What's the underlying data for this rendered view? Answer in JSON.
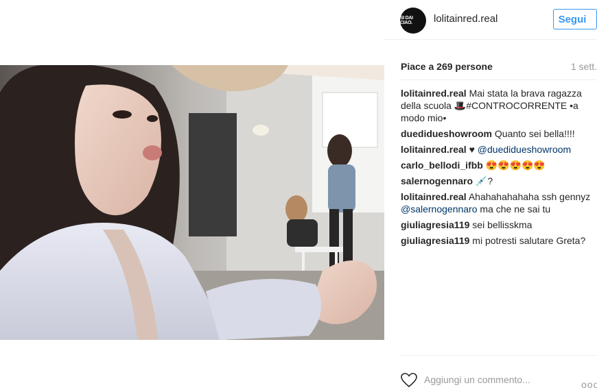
{
  "post": {
    "username": "lolitainred.real",
    "avatar_text": "SI DAI CIAO.",
    "follow_label": "Segui",
    "likes_text": "Piace a 269 persone",
    "time_text": "1 sett.",
    "add_comment_placeholder": "Aggiungi un commento...",
    "more_label": "ooo"
  },
  "comments": [
    {
      "user": "lolitainred.real",
      "pre": "",
      "mention": "",
      "text": "Mai stata la brava ragazza della scuola 🎩#CONTROCORRENTE •a modo mio•"
    },
    {
      "user": "duedidueshowroom",
      "pre": "",
      "mention": "",
      "text": "Quanto sei bella!!!!"
    },
    {
      "user": "lolitainred.real",
      "pre": "♥",
      "mention": "@duedidueshowroom",
      "text": ""
    },
    {
      "user": "carlo_bellodi_ifbb",
      "pre": "",
      "mention": "",
      "text": "😍😍😍😍😍"
    },
    {
      "user": "salernogennaro",
      "pre": "",
      "mention": "",
      "text": "💉?"
    },
    {
      "user": "lolitainred.real",
      "pre": "Ahahahahahaha ssh gennyz",
      "mention": "@salernogennaro",
      "text": "ma che ne sai tu"
    },
    {
      "user": "giuliagresia119",
      "pre": "",
      "mention": "",
      "text": "sei bellisskma"
    },
    {
      "user": "giuliagresia119",
      "pre": "",
      "mention": "",
      "text": "mi potresti salutare Greta?"
    }
  ],
  "colors": {
    "accent": "#3897f0",
    "mention": "#003569",
    "muted": "#999999"
  },
  "icons": {
    "like": "heart-outline-icon",
    "more": "more-dots-icon"
  }
}
